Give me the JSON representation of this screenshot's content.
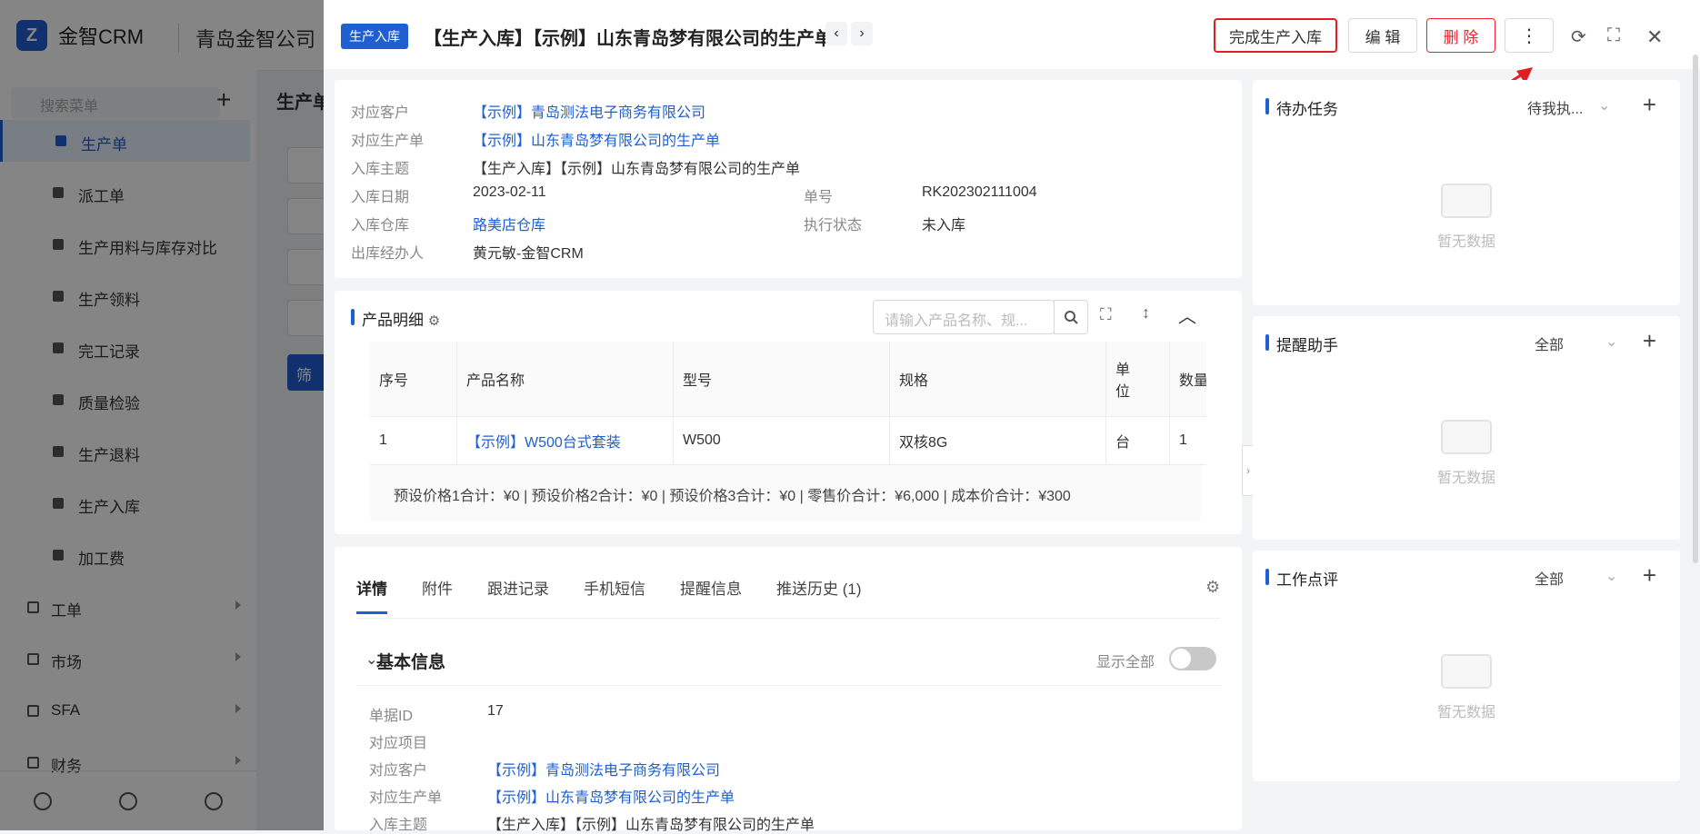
{
  "app": {
    "brand": "金智CRM",
    "company": "青岛金智公司"
  },
  "sidebar": {
    "search_placeholder": "搜索菜单",
    "items": [
      {
        "label": "生产单",
        "active": true
      },
      {
        "label": "派工单"
      },
      {
        "label": "生产用料与库存对比"
      },
      {
        "label": "生产领料"
      },
      {
        "label": "完工记录"
      },
      {
        "label": "质量检验"
      },
      {
        "label": "生产退料"
      },
      {
        "label": "生产入库"
      },
      {
        "label": "加工费"
      }
    ],
    "groups": [
      {
        "label": "工单"
      },
      {
        "label": "市场"
      },
      {
        "label": "SFA"
      },
      {
        "label": "财务"
      }
    ]
  },
  "background_page": {
    "title": "生产单",
    "filter_label": "筛"
  },
  "drawer": {
    "tag": "生产入库",
    "title": "【生产入库】【示例】山东青岛梦有限公司的生产单",
    "buttons": {
      "complete": "完成生产入库",
      "edit": "编 辑",
      "delete": "删 除"
    },
    "info": {
      "customer_label": "对应客户",
      "customer": "【示例】青岛测法电子商务有限公司",
      "order_label": "对应生产单",
      "order": "【示例】山东青岛梦有限公司的生产单",
      "subject_label": "入库主题",
      "subject": "【生产入库】【示例】山东青岛梦有限公司的生产单",
      "date_label": "入库日期",
      "date": "2023-02-11",
      "no_label": "单号",
      "no": "RK202302111004",
      "warehouse_label": "入库仓库",
      "warehouse": "路美店仓库",
      "status_label": "执行状态",
      "status": "未入库",
      "handler_label": "出库经办人",
      "handler": "黄元敏-金智CRM"
    },
    "products": {
      "title": "产品明细",
      "search_placeholder": "请输入产品名称、规...",
      "headers": [
        "序号",
        "产品名称",
        "型号",
        "规格",
        "单位",
        "数量"
      ],
      "rows": [
        [
          "1",
          "【示例】W500台式套装",
          "W500",
          "双核8G",
          "台",
          "1"
        ]
      ],
      "summary": "预设价格1合计：¥0 |   预设价格2合计：¥0 |   预设价格3合计：¥0 |   零售价合计：¥6,000 |   成本价合计：¥300"
    },
    "tabs": [
      "详情",
      "附件",
      "跟进记录",
      "手机短信",
      "提醒信息",
      "推送历史 (1)"
    ],
    "basic": {
      "title": "基本信息",
      "show_all": "显示全部",
      "fields": [
        {
          "label": "单据ID",
          "value": "17"
        },
        {
          "label": "对应项目",
          "value": ""
        },
        {
          "label": "对应客户",
          "value": "【示例】青岛测法电子商务有限公司"
        },
        {
          "label": "对应生产单",
          "value": "【示例】山东青岛梦有限公司的生产单"
        },
        {
          "label": "入库主题",
          "value": "【生产入库】【示例】山东青岛梦有限公司的生产单"
        }
      ]
    },
    "side_panels": [
      {
        "title": "待办任务",
        "filter": "待我执...",
        "empty": "暂无数据"
      },
      {
        "title": "提醒助手",
        "filter": "全部",
        "empty": "暂无数据"
      },
      {
        "title": "工作点评",
        "filter": "全部",
        "empty": "暂无数据"
      }
    ]
  },
  "colors": {
    "accent": "#1f5fd1",
    "danger": "#f5222d",
    "highlight_border": "#e02020"
  }
}
